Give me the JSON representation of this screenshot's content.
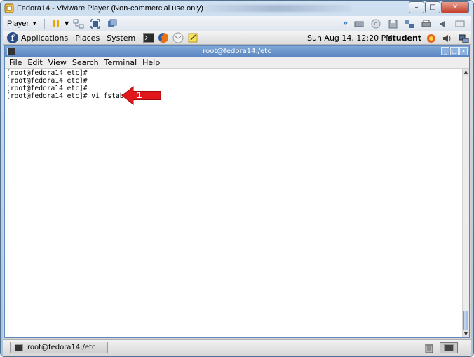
{
  "vmware": {
    "title": "Fedora14 - VMware Player (Non-commercial use only)",
    "player_label": "Player",
    "window_buttons": [
      "minimize",
      "maximize",
      "close"
    ]
  },
  "gnome_panel": {
    "menus": [
      "Applications",
      "Places",
      "System"
    ],
    "clock": "Sun Aug 14, 12:20 PM",
    "user": "student"
  },
  "terminal": {
    "title": "root@fedora14:/etc",
    "menu": [
      "File",
      "Edit",
      "View",
      "Search",
      "Terminal",
      "Help"
    ],
    "lines": [
      "[root@fedora14 etc]#",
      "[root@fedora14 etc]#",
      "[root@fedora14 etc]#",
      "[root@fedora14 etc]# vi fstab"
    ]
  },
  "annotation": {
    "label": "1",
    "color": "#e0171b"
  },
  "taskbar": {
    "task_label": "root@fedora14:/etc"
  },
  "colors": {
    "terminal_title": "#5a86c0",
    "accent": "#e0171b"
  }
}
